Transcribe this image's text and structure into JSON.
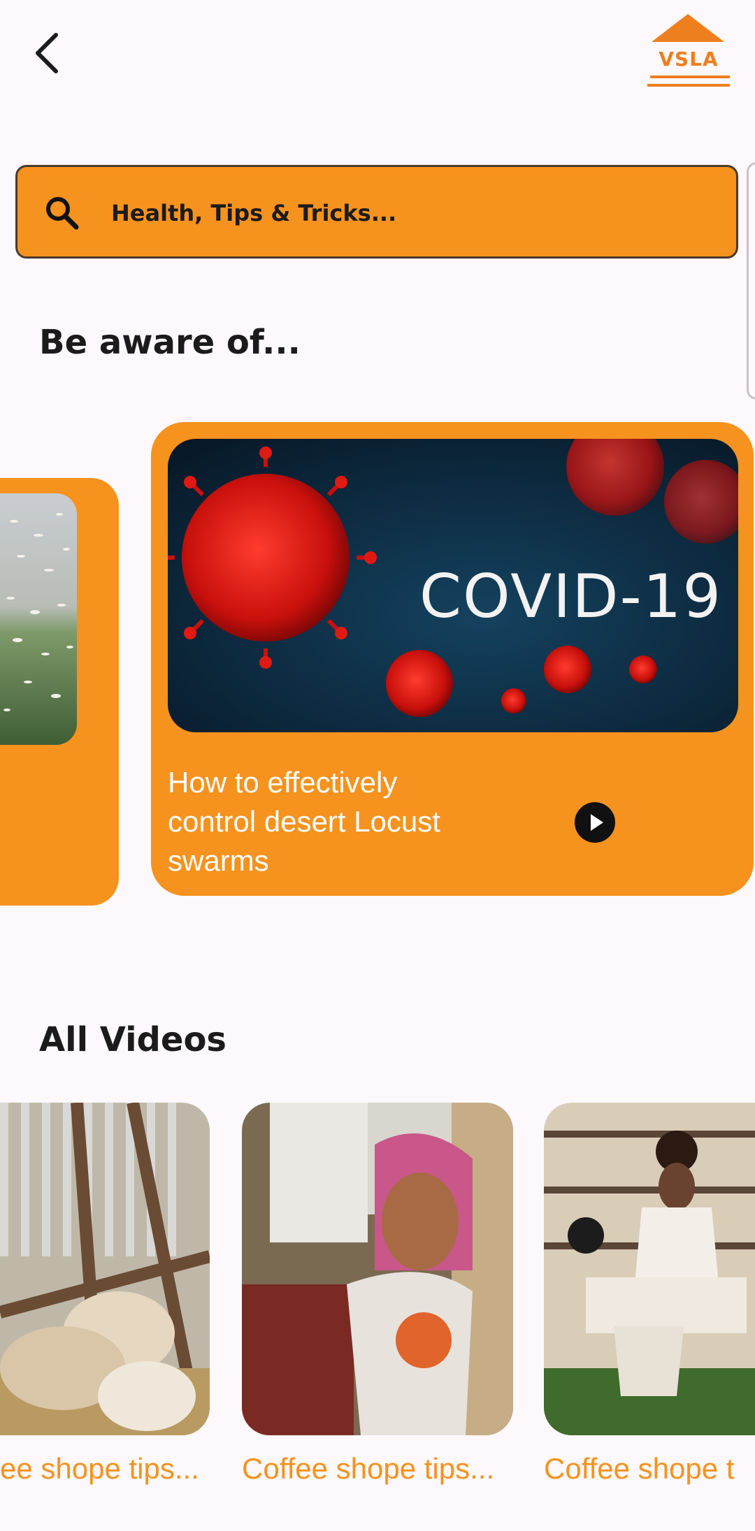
{
  "header": {
    "back_icon": "chevron-left-icon",
    "logo_text": "VSLA",
    "brand_color": "#EE7F1F"
  },
  "search": {
    "icon": "search-icon",
    "placeholder": "Health, Tips & Tricks..."
  },
  "aware": {
    "heading": "Be aware of...",
    "cards": [
      {
        "image": "desert-locust-swarm-photo",
        "caption": ""
      },
      {
        "image": "covid-19-virus-image",
        "image_text": "COVID-19",
        "caption": "How to effectively control desert Locust swarms",
        "play_icon": "play-icon"
      }
    ]
  },
  "videos": {
    "heading": "All Videos",
    "items": [
      {
        "image": "sheep-in-pen-photo",
        "title": "ee shope tips..."
      },
      {
        "image": "woman-seller-photo",
        "title": "Coffee shope tips..."
      },
      {
        "image": "coffee-ceremony-photo",
        "title": "Coffee shope t"
      }
    ]
  },
  "colors": {
    "accent": "#F6921E",
    "background": "#FCF8FB"
  }
}
